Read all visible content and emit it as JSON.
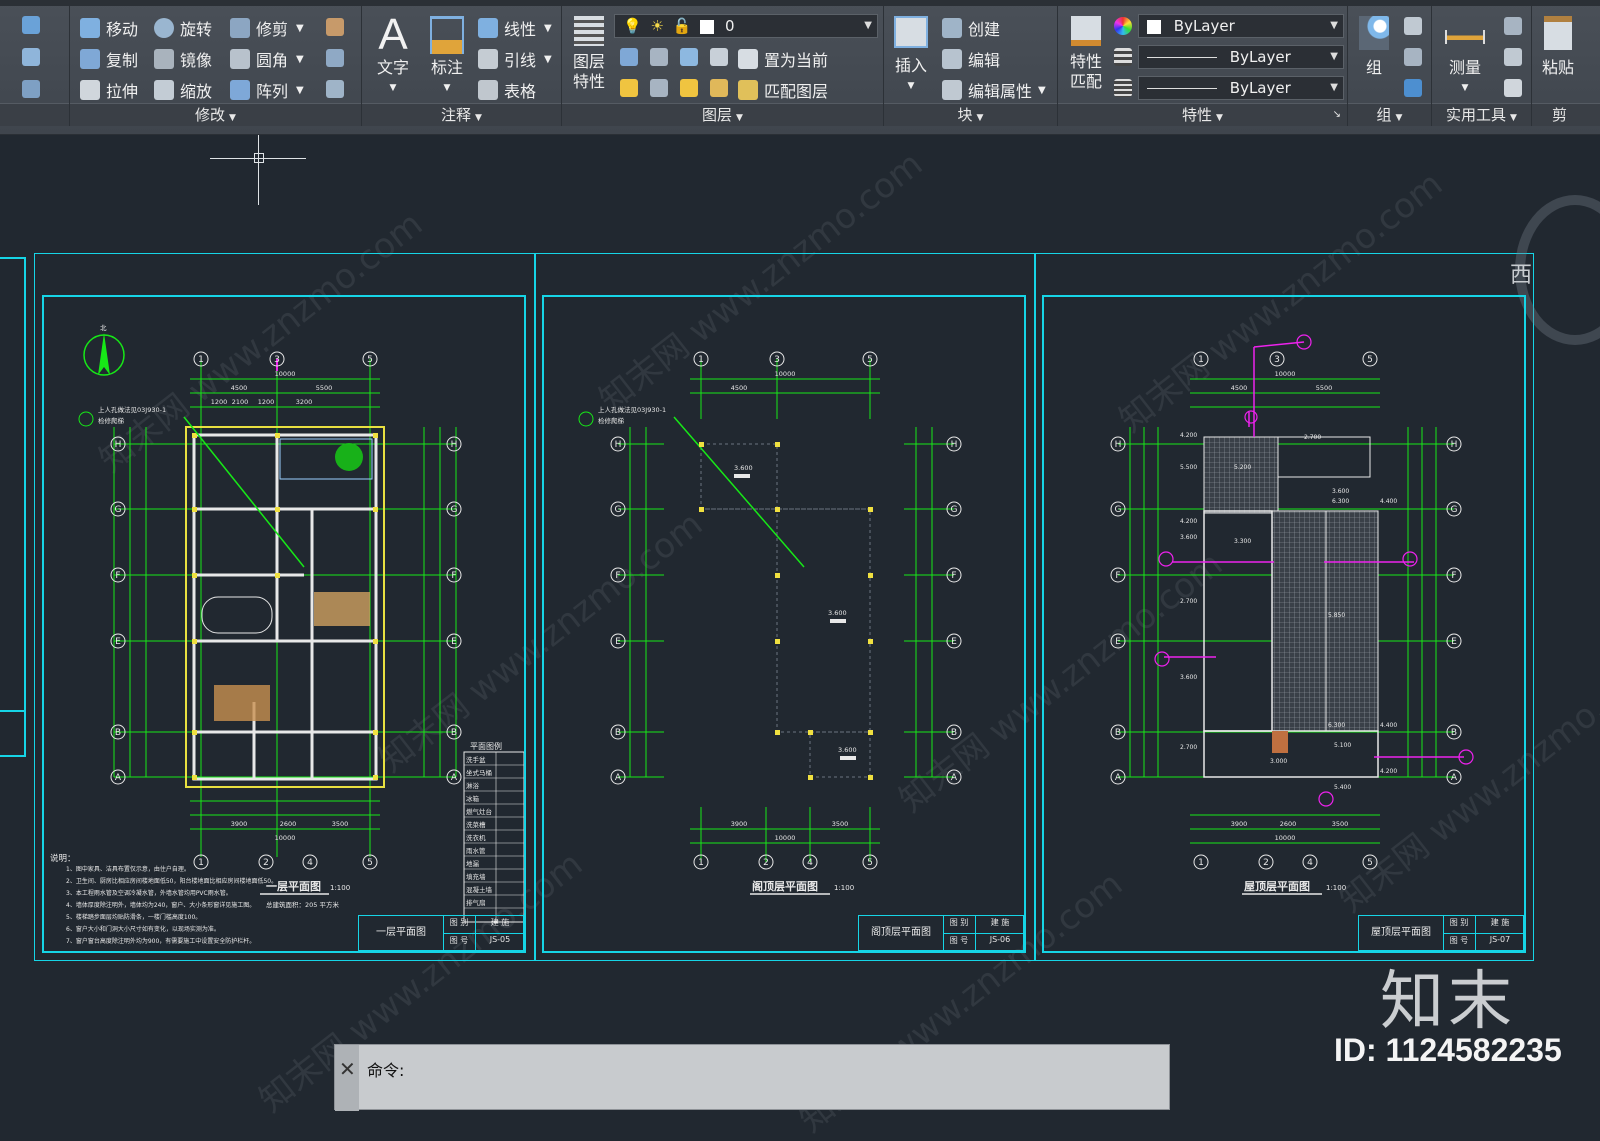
{
  "ribbon": {
    "modify": {
      "label": "修改",
      "move": "移动",
      "rotate": "旋转",
      "trim": "修剪",
      "copy": "复制",
      "mirror": "镜像",
      "fillet": "圆角",
      "stretch": "拉伸",
      "scale": "缩放",
      "array": "阵列"
    },
    "annotation": {
      "label": "注释",
      "text": "文字",
      "dimension": "标注",
      "linear": "线性",
      "leader": "引线",
      "table": "表格"
    },
    "layers": {
      "label": "图层",
      "properties_line1": "图层",
      "properties_line2": "特性",
      "current_layer": "0",
      "set_current": "置为当前",
      "match_layer": "匹配图层"
    },
    "block": {
      "label": "块",
      "insert": "插入",
      "create": "创建",
      "edit": "编辑",
      "edit_attributes": "编辑属性"
    },
    "properties": {
      "label": "特性",
      "match_line1": "特性",
      "match_line2": "匹配",
      "color": "ByLayer",
      "linetype": "ByLayer",
      "lineweight": "ByLayer"
    },
    "group": {
      "label": "组",
      "group": "组"
    },
    "utilities": {
      "label": "实用工具",
      "measure": "测量"
    },
    "clipboard": {
      "label": "剪",
      "paste": "粘贴"
    }
  },
  "drawing": {
    "viewcube_label": "西",
    "sheets": [
      {
        "title": "一层平面图",
        "scale": "1:100",
        "title_block_name": "一层平面图",
        "drawing_no": "JS-05",
        "tb_category": "图 别",
        "tb_category_val": "建 施",
        "tb_no_label": "图 号",
        "area_note": "总建筑面积：205 平方米",
        "north": "北",
        "note_header": "说明：",
        "notes": [
          "1、图中家具、洁具布置仅示意，由住户自理。",
          "2、卫生间、厨房比相应房间楼地面低50，阳台楼地面比相应房间楼地面低50。",
          "3、本工程雨水管及空调冷凝水管，外墙水管均用PVC雨水管。",
          "4、墙体厚度除注明外，墙体均为240，窗户、大小条形窗详见施工图。",
          "5、楼梯踏步面层均贴防滑条，一楼门槛高度100。",
          "6、窗户大小和门洞大小尺寸如有变化，以现场实测为准。",
          "7、窗户窗台高度除注明外均为900，有需要施工中设置安全防护栏杆。",
          "8、室内楼梯踏步高度120。"
        ],
        "legend_title": "平面图例",
        "legend_items": [
          "洗手盆",
          "坐式马桶",
          "淋浴",
          "冰箱",
          "燃气灶台",
          "洗菜槽",
          "洗衣机",
          "雨水管",
          "地漏",
          "填充墙",
          "混凝土墙",
          "排气扇"
        ],
        "stair_note_line1": "上人孔做法见03J930-1",
        "stair_note_line2": "检修爬梯"
      },
      {
        "title": "阁顶层平面图",
        "scale": "1:100",
        "title_block_name": "阁顶层平面图",
        "drawing_no": "JS-06",
        "tb_category": "图 别",
        "tb_category_val": "建 施",
        "tb_no_label": "图 号",
        "stair_note_line1": "上人孔做法见03J930-1",
        "stair_note_line2": "检修爬梯",
        "elevations": [
          "3.600",
          "3.600",
          "3.600"
        ]
      },
      {
        "title": "屋顶层平面图",
        "scale": "1:100",
        "title_block_name": "屋顶层平面图",
        "drawing_no": "JS-07",
        "tb_category": "图 别",
        "tb_category_val": "建 施",
        "tb_no_label": "图 号",
        "elevations": [
          "4.200",
          "5.500",
          "4.200",
          "3.600",
          "2.700",
          "3.600",
          "2.700",
          "5.200",
          "3.600",
          "6.300",
          "4.400",
          "3.300",
          "5.850",
          "6.300",
          "4.400",
          "5.100",
          "4.200",
          "3.000",
          "5.400",
          "2.700"
        ]
      }
    ],
    "axes_vertical": [
      "H",
      "G",
      "F",
      "E",
      "D",
      "C",
      "B",
      "A"
    ],
    "axes_horizontal_top": [
      "1",
      "3",
      "5"
    ],
    "axes_horizontal_bottom": [
      "1",
      "2",
      "4",
      "5"
    ],
    "top_dims": [
      "10000",
      "4500",
      "5500",
      "120",
      "120",
      "1200",
      "2100",
      "1200",
      "3200",
      "300",
      "300"
    ],
    "bottom_dims": [
      "120",
      "3900",
      "2600",
      "3500",
      "120",
      "10000"
    ],
    "side_dims": [
      "3900",
      "3900",
      "3900",
      "3900",
      "5400",
      "2700",
      "19800"
    ]
  },
  "watermark": "知末网 www.znzmo.com",
  "brand": {
    "logo": "知末",
    "id": "ID: 1124582235"
  },
  "command": {
    "prompt": "命令:"
  },
  "colors": {
    "frame": "#16d5e6",
    "background": "#212830",
    "grid": "#17e817",
    "walls": "#e8e8e8"
  }
}
